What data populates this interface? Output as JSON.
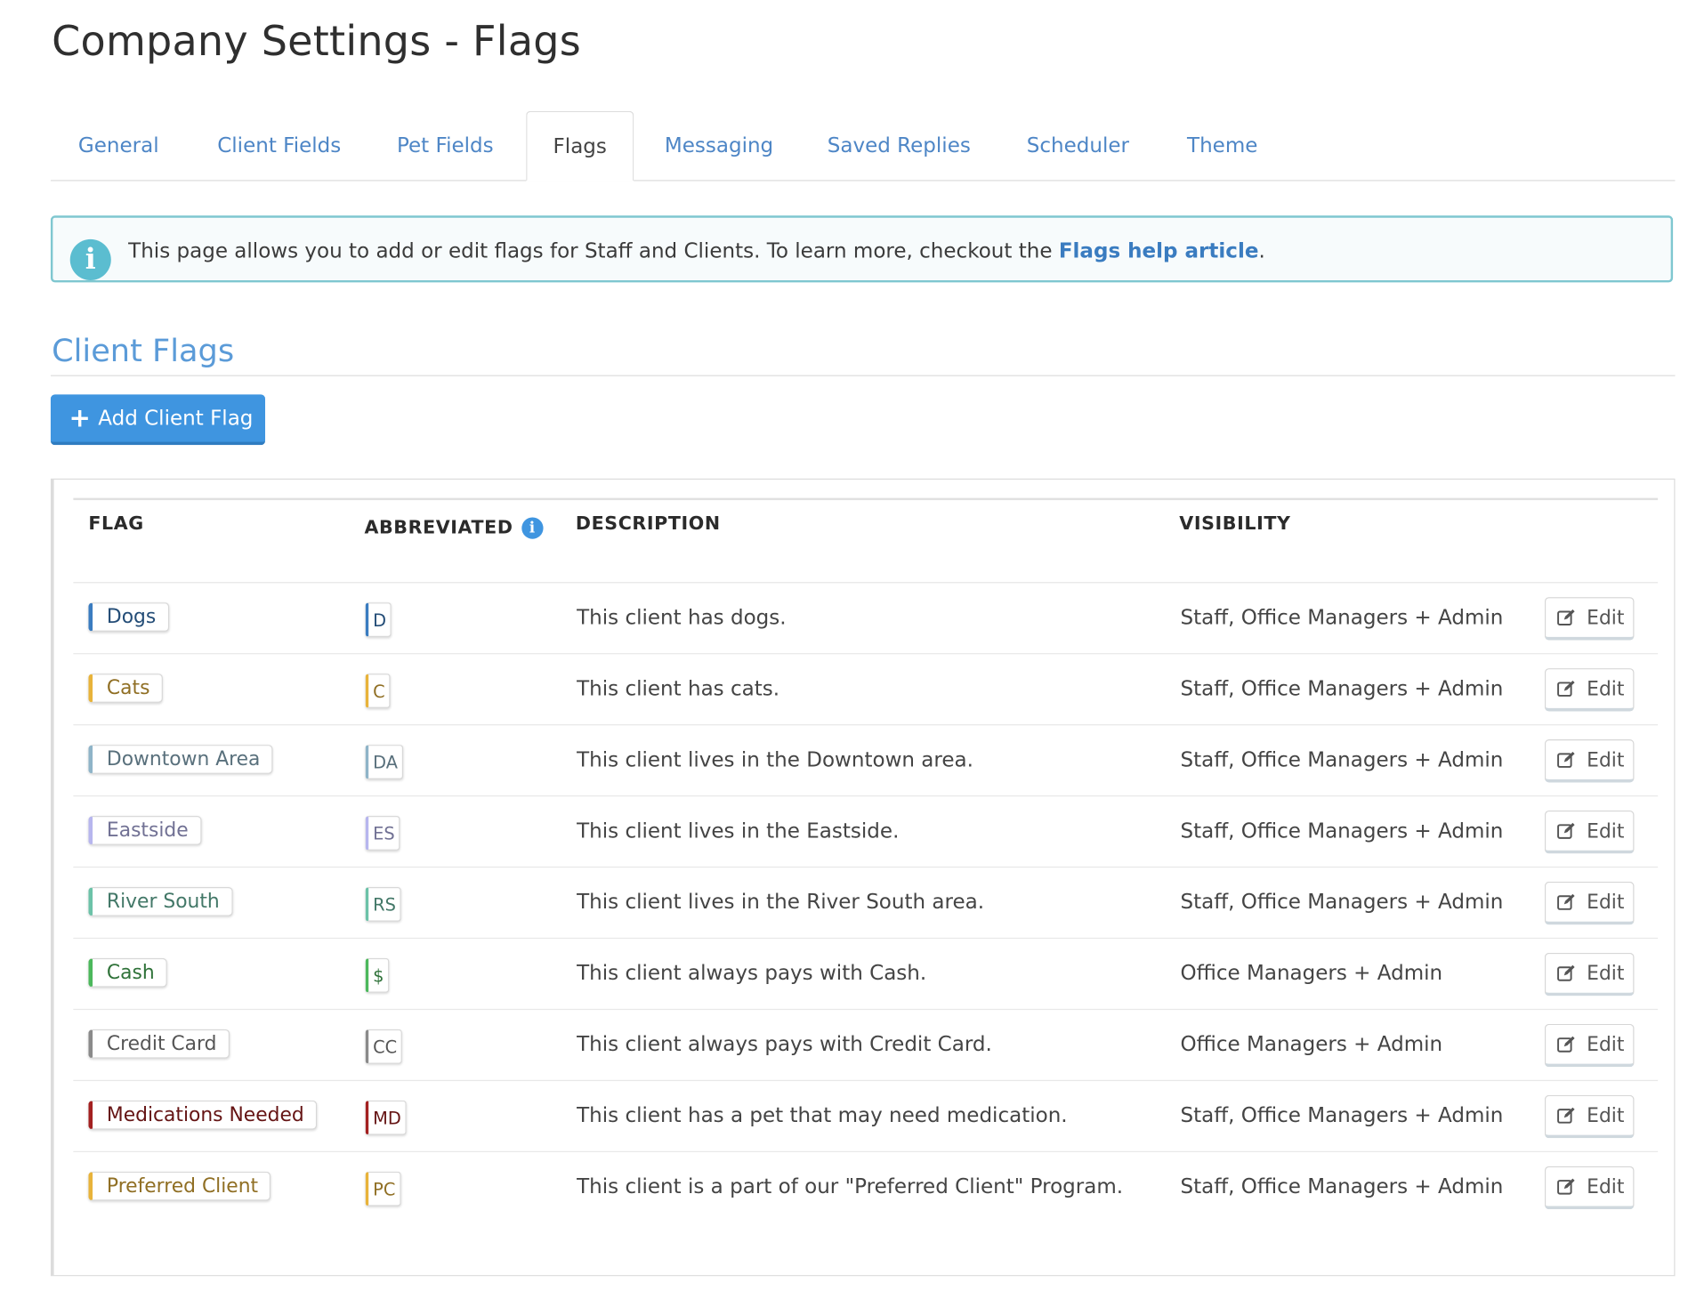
{
  "page": {
    "title": "Company Settings - Flags"
  },
  "tabs": [
    {
      "label": "General"
    },
    {
      "label": "Client Fields"
    },
    {
      "label": "Pet Fields"
    },
    {
      "label": "Flags",
      "active": true
    },
    {
      "label": "Messaging"
    },
    {
      "label": "Saved Replies"
    },
    {
      "label": "Scheduler"
    },
    {
      "label": "Theme"
    }
  ],
  "alert": {
    "text": "This page allows you to add or edit flags for Staff and Clients. To learn more, checkout the ",
    "link_text": "Flags help article",
    "suffix": "."
  },
  "section": {
    "title": "Client Flags",
    "add_button_label": "Add Client Flag"
  },
  "table": {
    "headers": {
      "flag": "FLAG",
      "abbreviated": "ABBREVIATED",
      "description": "DESCRIPTION",
      "visibility": "VISIBILITY"
    },
    "edit_label": "Edit",
    "rows": [
      {
        "flag": "Dogs",
        "abbr": "D",
        "description": "This client has dogs.",
        "visibility": "Staff, Office Managers + Admin",
        "color": "#3a7cc0"
      },
      {
        "flag": "Cats",
        "abbr": "C",
        "description": "This client has cats.",
        "visibility": "Staff, Office Managers + Admin",
        "color": "#e8b33a"
      },
      {
        "flag": "Downtown Area",
        "abbr": "DA",
        "description": "This client lives in the Downtown area.",
        "visibility": "Staff, Office Managers + Admin",
        "color": "#8fb4c8"
      },
      {
        "flag": "Eastside",
        "abbr": "ES",
        "description": "This client lives in the Eastside.",
        "visibility": "Staff, Office Managers + Admin",
        "color": "#b7b6ee"
      },
      {
        "flag": "River South",
        "abbr": "RS",
        "description": "This client lives in the River South area.",
        "visibility": "Staff, Office Managers + Admin",
        "color": "#6cc2a8"
      },
      {
        "flag": "Cash",
        "abbr": "$",
        "description": "This client always pays with Cash.",
        "visibility": "Office Managers + Admin",
        "color": "#4cb85c"
      },
      {
        "flag": "Credit Card",
        "abbr": "CC",
        "description": "This client always pays with Credit Card.",
        "visibility": "Office Managers + Admin",
        "color": "#8a8a8a"
      },
      {
        "flag": "Medications Needed",
        "abbr": "MD",
        "description": "This client has a pet that may need medication.",
        "visibility": "Staff, Office Managers + Admin",
        "color": "#a32020"
      },
      {
        "flag": "Preferred Client",
        "abbr": "PC",
        "description": "This client is a part of our \"Preferred Client\" Program.",
        "visibility": "Staff, Office Managers + Admin",
        "color": "#e8b33a"
      }
    ]
  }
}
